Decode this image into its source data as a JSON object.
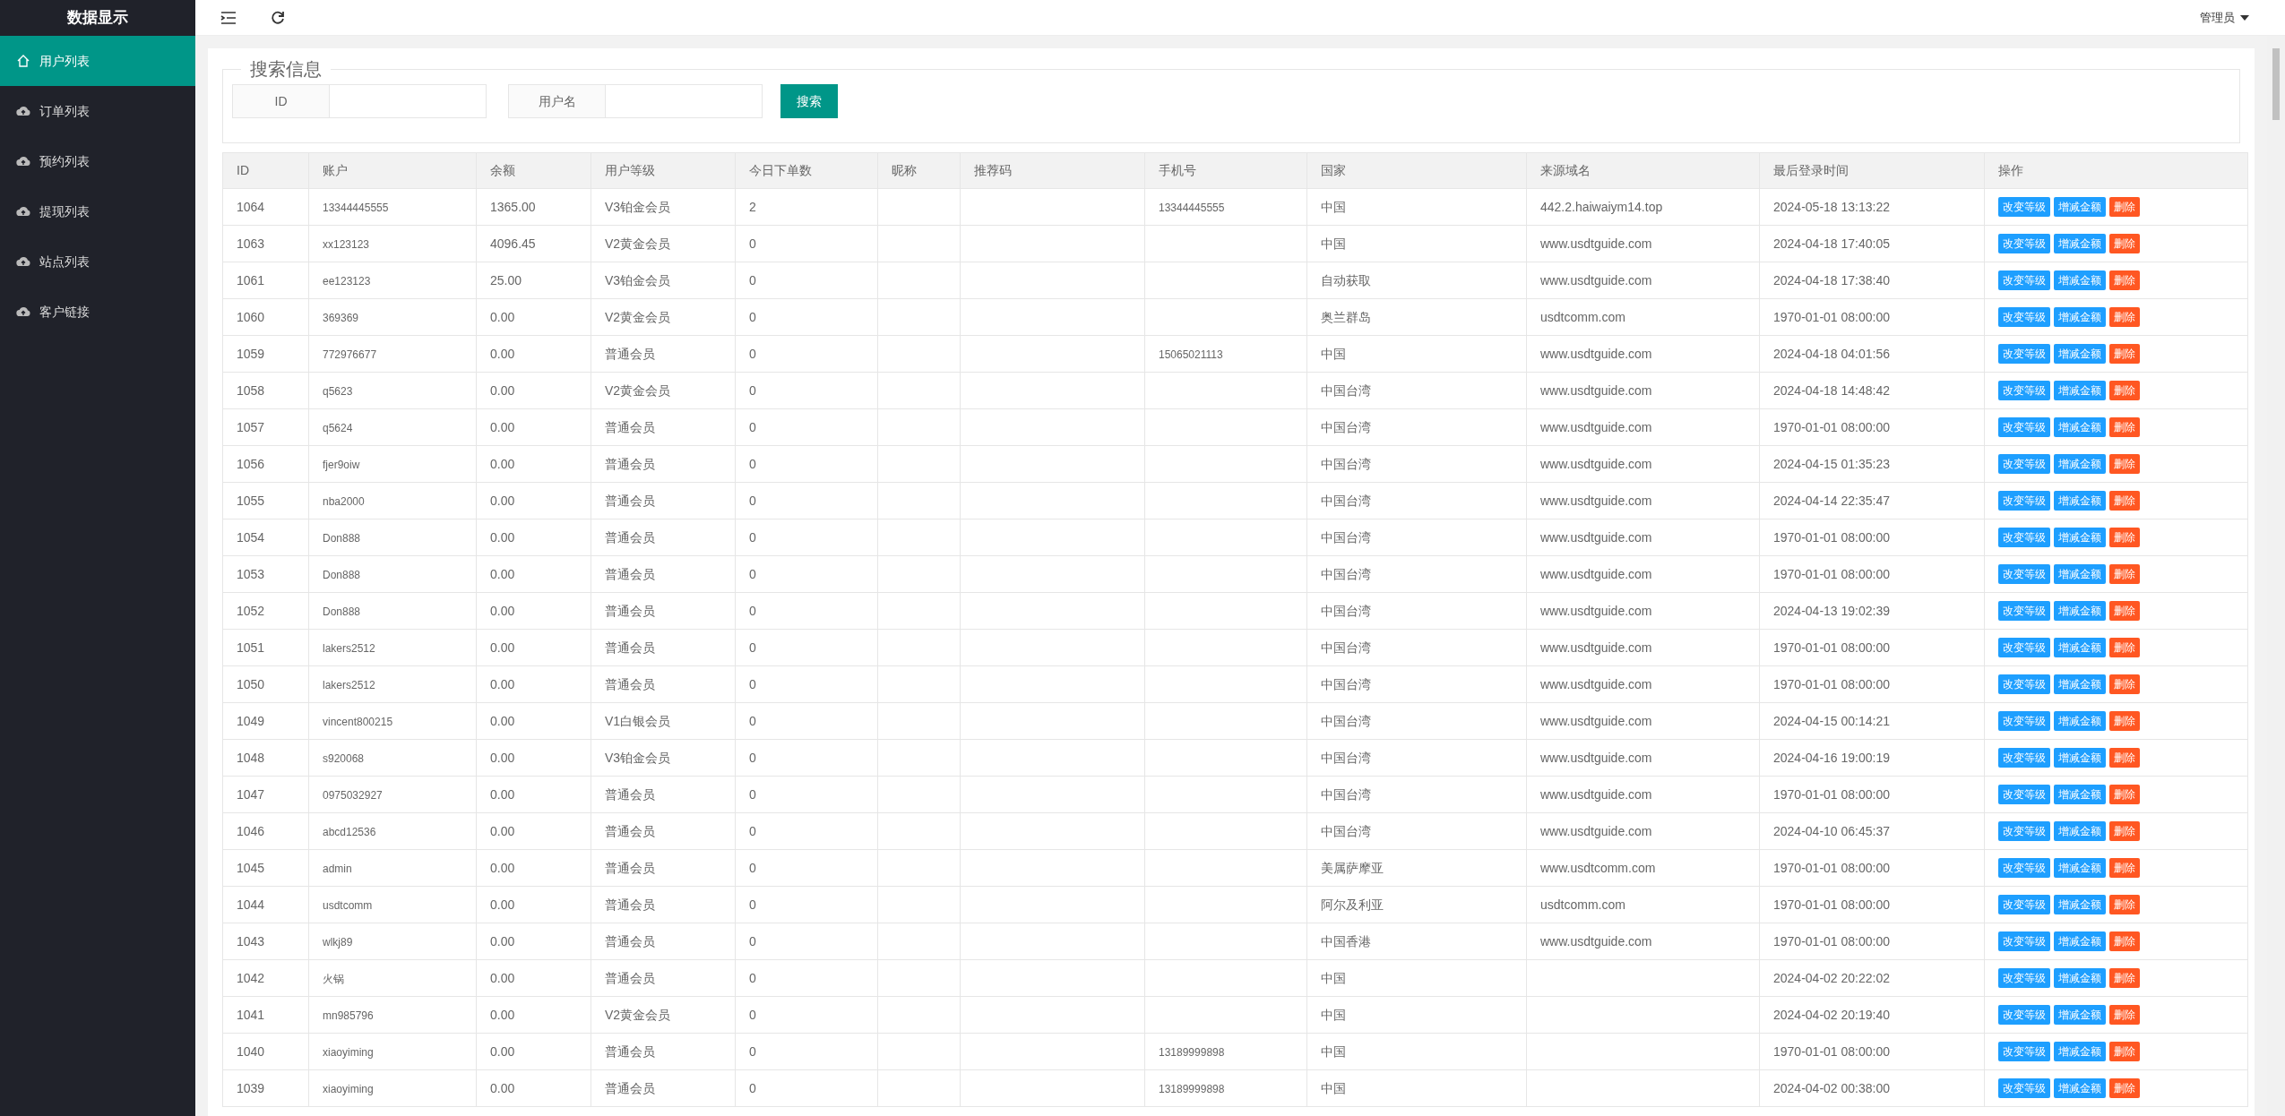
{
  "sidebar": {
    "title": "数据显示",
    "items": [
      {
        "label": "用户列表",
        "selected": true
      },
      {
        "label": "订单列表",
        "selected": false
      },
      {
        "label": "预约列表",
        "selected": false
      },
      {
        "label": "提现列表",
        "selected": false
      },
      {
        "label": "站点列表",
        "selected": false
      },
      {
        "label": "客户链接",
        "selected": false
      }
    ]
  },
  "header": {
    "user": "管理员"
  },
  "search": {
    "legend": "搜索信息",
    "fields": [
      {
        "label": "ID"
      },
      {
        "label": "用户名"
      }
    ],
    "button": "搜索"
  },
  "table": {
    "columns": [
      "ID",
      "账户",
      "余额",
      "用户等级",
      "今日下单数",
      "昵称",
      "推荐码",
      "手机号",
      "国家",
      "来源域名",
      "最后登录时间",
      "操作"
    ],
    "rows": [
      {
        "id": "1064",
        "account": "13344445555",
        "balance": "1365.00",
        "level": "V3铂金会员",
        "orders": "2",
        "phone": "13344445555",
        "country": "中国",
        "source": "442.2.haiwaiym14.top",
        "last_login": "2024-05-18 13:13:22",
        "actions": [
          {
            "label": "改变等级",
            "kind": "normal"
          },
          {
            "label": "增减金额",
            "kind": "normal"
          },
          {
            "label": "删除",
            "kind": "danger"
          }
        ]
      },
      {
        "id": "1063",
        "account": "xx123123",
        "balance": "4096.45",
        "level": "V2黄金会员",
        "orders": "0",
        "country": "中国",
        "source": "www.usdtguide.com",
        "last_login": "2024-04-18 17:40:05",
        "actions": [
          {
            "label": "改变等级",
            "kind": "normal"
          },
          {
            "label": "增减金额",
            "kind": "normal"
          },
          {
            "label": "删除",
            "kind": "danger"
          }
        ]
      },
      {
        "id": "1061",
        "account": "ee123123",
        "balance": "25.00",
        "level": "V3铂金会员",
        "orders": "0",
        "country": "自动获取",
        "source": "www.usdtguide.com",
        "last_login": "2024-04-18 17:38:40",
        "actions": [
          {
            "label": "改变等级",
            "kind": "normal"
          },
          {
            "label": "增减金额",
            "kind": "normal"
          },
          {
            "label": "删除",
            "kind": "danger"
          }
        ]
      },
      {
        "id": "1060",
        "account": "369369",
        "balance": "0.00",
        "level": "V2黄金会员",
        "orders": "0",
        "country": "奥兰群岛",
        "source": "usdtcomm.com",
        "last_login": "1970-01-01 08:00:00",
        "actions": [
          {
            "label": "改变等级",
            "kind": "normal"
          },
          {
            "label": "增减金额",
            "kind": "normal"
          },
          {
            "label": "删除",
            "kind": "danger"
          }
        ]
      },
      {
        "id": "1059",
        "account": "772976677",
        "balance": "0.00",
        "level": "普通会员",
        "orders": "0",
        "phone": "15065021113",
        "country": "中国",
        "source": "www.usdtguide.com",
        "last_login": "2024-04-18 04:01:56",
        "actions": [
          {
            "label": "改变等级",
            "kind": "normal"
          },
          {
            "label": "增减金额",
            "kind": "normal"
          },
          {
            "label": "删除",
            "kind": "danger"
          }
        ]
      },
      {
        "id": "1058",
        "account": "q5623",
        "balance": "0.00",
        "level": "V2黄金会员",
        "orders": "0",
        "country": "中国台湾",
        "source": "www.usdtguide.com",
        "last_login": "2024-04-18 14:48:42",
        "actions": [
          {
            "label": "改变等级",
            "kind": "normal"
          },
          {
            "label": "增减金额",
            "kind": "normal"
          },
          {
            "label": "删除",
            "kind": "danger"
          }
        ]
      },
      {
        "id": "1057",
        "account": "q5624",
        "balance": "0.00",
        "level": "普通会员",
        "orders": "0",
        "country": "中国台湾",
        "source": "www.usdtguide.com",
        "last_login": "1970-01-01 08:00:00",
        "actions": [
          {
            "label": "改变等级",
            "kind": "normal"
          },
          {
            "label": "增减金额",
            "kind": "normal"
          },
          {
            "label": "删除",
            "kind": "danger"
          }
        ]
      },
      {
        "id": "1056",
        "account": "fjer9oiw",
        "balance": "0.00",
        "level": "普通会员",
        "orders": "0",
        "country": "中国台湾",
        "source": "www.usdtguide.com",
        "last_login": "2024-04-15 01:35:23",
        "actions": [
          {
            "label": "改变等级",
            "kind": "normal"
          },
          {
            "label": "增减金额",
            "kind": "normal"
          },
          {
            "label": "删除",
            "kind": "danger"
          }
        ]
      },
      {
        "id": "1055",
        "account": "nba2000",
        "balance": "0.00",
        "level": "普通会员",
        "orders": "0",
        "country": "中国台湾",
        "source": "www.usdtguide.com",
        "last_login": "2024-04-14 22:35:47",
        "actions": [
          {
            "label": "改变等级",
            "kind": "normal"
          },
          {
            "label": "增减金额",
            "kind": "normal"
          },
          {
            "label": "删除",
            "kind": "danger"
          }
        ]
      },
      {
        "id": "1054",
        "account": "Don888",
        "balance": "0.00",
        "level": "普通会员",
        "orders": "0",
        "country": "中国台湾",
        "source": "www.usdtguide.com",
        "last_login": "1970-01-01 08:00:00",
        "actions": [
          {
            "label": "改变等级",
            "kind": "normal"
          },
          {
            "label": "增减金额",
            "kind": "normal"
          },
          {
            "label": "删除",
            "kind": "danger"
          }
        ]
      },
      {
        "id": "1053",
        "account": "Don888",
        "balance": "0.00",
        "level": "普通会员",
        "orders": "0",
        "country": "中国台湾",
        "source": "www.usdtguide.com",
        "last_login": "1970-01-01 08:00:00",
        "actions": [
          {
            "label": "改变等级",
            "kind": "normal"
          },
          {
            "label": "增减金额",
            "kind": "normal"
          },
          {
            "label": "删除",
            "kind": "danger"
          }
        ]
      },
      {
        "id": "1052",
        "account": "Don888",
        "balance": "0.00",
        "level": "普通会员",
        "orders": "0",
        "country": "中国台湾",
        "source": "www.usdtguide.com",
        "last_login": "2024-04-13 19:02:39",
        "actions": [
          {
            "label": "改变等级",
            "kind": "normal"
          },
          {
            "label": "增减金额",
            "kind": "normal"
          },
          {
            "label": "删除",
            "kind": "danger"
          }
        ]
      },
      {
        "id": "1051",
        "account": "lakers2512",
        "balance": "0.00",
        "level": "普通会员",
        "orders": "0",
        "country": "中国台湾",
        "source": "www.usdtguide.com",
        "last_login": "1970-01-01 08:00:00",
        "actions": [
          {
            "label": "改变等级",
            "kind": "normal"
          },
          {
            "label": "增减金额",
            "kind": "normal"
          },
          {
            "label": "删除",
            "kind": "danger"
          }
        ]
      },
      {
        "id": "1050",
        "account": "lakers2512",
        "balance": "0.00",
        "level": "普通会员",
        "orders": "0",
        "country": "中国台湾",
        "source": "www.usdtguide.com",
        "last_login": "1970-01-01 08:00:00",
        "actions": [
          {
            "label": "改变等级",
            "kind": "normal"
          },
          {
            "label": "增减金额",
            "kind": "normal"
          },
          {
            "label": "删除",
            "kind": "danger"
          }
        ]
      },
      {
        "id": "1049",
        "account": "vincent800215",
        "balance": "0.00",
        "level": "V1白银会员",
        "orders": "0",
        "country": "中国台湾",
        "source": "www.usdtguide.com",
        "last_login": "2024-04-15 00:14:21",
        "actions": [
          {
            "label": "改变等级",
            "kind": "normal"
          },
          {
            "label": "增减金额",
            "kind": "normal"
          },
          {
            "label": "删除",
            "kind": "danger"
          }
        ]
      },
      {
        "id": "1048",
        "account": "s920068",
        "balance": "0.00",
        "level": "V3铂金会员",
        "orders": "0",
        "country": "中国台湾",
        "source": "www.usdtguide.com",
        "last_login": "2024-04-16 19:00:19",
        "actions": [
          {
            "label": "改变等级",
            "kind": "normal"
          },
          {
            "label": "增减金额",
            "kind": "normal"
          },
          {
            "label": "删除",
            "kind": "danger"
          }
        ]
      },
      {
        "id": "1047",
        "account": "0975032927",
        "balance": "0.00",
        "level": "普通会员",
        "orders": "0",
        "country": "中国台湾",
        "source": "www.usdtguide.com",
        "last_login": "1970-01-01 08:00:00",
        "actions": [
          {
            "label": "改变等级",
            "kind": "normal"
          },
          {
            "label": "增减金额",
            "kind": "normal"
          },
          {
            "label": "删除",
            "kind": "danger"
          }
        ]
      },
      {
        "id": "1046",
        "account": "abcd12536",
        "balance": "0.00",
        "level": "普通会员",
        "orders": "0",
        "country": "中国台湾",
        "source": "www.usdtguide.com",
        "last_login": "2024-04-10 06:45:37",
        "actions": [
          {
            "label": "改变等级",
            "kind": "normal"
          },
          {
            "label": "增减金额",
            "kind": "normal"
          },
          {
            "label": "删除",
            "kind": "danger"
          }
        ]
      },
      {
        "id": "1045",
        "account": "admin",
        "balance": "0.00",
        "level": "普通会员",
        "orders": "0",
        "country": "美属萨摩亚",
        "source": "www.usdtcomm.com",
        "last_login": "1970-01-01 08:00:00",
        "actions": [
          {
            "label": "改变等级",
            "kind": "normal"
          },
          {
            "label": "增减金额",
            "kind": "normal"
          },
          {
            "label": "删除",
            "kind": "danger"
          }
        ]
      },
      {
        "id": "1044",
        "account": "usdtcomm",
        "balance": "0.00",
        "level": "普通会员",
        "orders": "0",
        "country": "阿尔及利亚",
        "source": "usdtcomm.com",
        "last_login": "1970-01-01 08:00:00",
        "actions": [
          {
            "label": "改变等级",
            "kind": "normal"
          },
          {
            "label": "增减金额",
            "kind": "normal"
          },
          {
            "label": "删除",
            "kind": "danger"
          }
        ]
      },
      {
        "id": "1043",
        "account": "wlkj89",
        "balance": "0.00",
        "level": "普通会员",
        "orders": "0",
        "country": "中国香港",
        "source": "www.usdtguide.com",
        "last_login": "1970-01-01 08:00:00",
        "actions": [
          {
            "label": "改变等级",
            "kind": "normal"
          },
          {
            "label": "增减金额",
            "kind": "normal"
          },
          {
            "label": "删除",
            "kind": "danger"
          }
        ]
      },
      {
        "id": "1042",
        "account": "火锅",
        "balance": "0.00",
        "level": "普通会员",
        "orders": "0",
        "country": "中国",
        "last_login": "2024-04-02 20:22:02",
        "actions": [
          {
            "label": "改变等级",
            "kind": "normal"
          },
          {
            "label": "增减金额",
            "kind": "normal"
          },
          {
            "label": "删除",
            "kind": "danger"
          }
        ]
      },
      {
        "id": "1041",
        "account": "mn985796",
        "balance": "0.00",
        "level": "V2黄金会员",
        "orders": "0",
        "country": "中国",
        "last_login": "2024-04-02 20:19:40",
        "actions": [
          {
            "label": "改变等级",
            "kind": "normal"
          },
          {
            "label": "增减金额",
            "kind": "normal"
          },
          {
            "label": "删除",
            "kind": "danger"
          }
        ]
      },
      {
        "id": "1040",
        "account": "xiaoyiming",
        "balance": "0.00",
        "level": "普通会员",
        "orders": "0",
        "phone": "13189999898",
        "country": "中国",
        "last_login": "1970-01-01 08:00:00",
        "actions": [
          {
            "label": "改变等级",
            "kind": "normal"
          },
          {
            "label": "增减金额",
            "kind": "normal"
          },
          {
            "label": "删除",
            "kind": "danger"
          }
        ]
      },
      {
        "id": "1039",
        "account": "xiaoyiming",
        "balance": "0.00",
        "level": "普通会员",
        "orders": "0",
        "phone": "13189999898",
        "country": "中国",
        "last_login": "2024-04-02 00:38:00",
        "actions": [
          {
            "label": "改变等级",
            "kind": "normal"
          },
          {
            "label": "增减金额",
            "kind": "normal"
          },
          {
            "label": "删除",
            "kind": "danger"
          }
        ]
      }
    ]
  }
}
